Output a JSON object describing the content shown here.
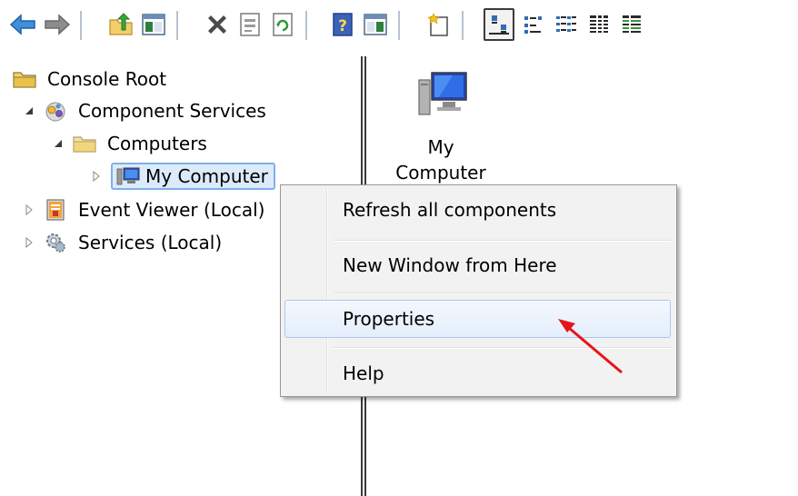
{
  "toolbar": {
    "buttons": [
      {
        "id": "back",
        "icon": "back-arrow-icon"
      },
      {
        "id": "forward",
        "icon": "forward-arrow-icon"
      },
      {
        "id": "up-one-level",
        "icon": "up-folder-icon"
      },
      {
        "id": "show-hide-console-tree",
        "icon": "console-tree-icon"
      },
      {
        "id": "delete",
        "icon": "delete-x-icon"
      },
      {
        "id": "properties",
        "icon": "properties-sheet-icon"
      },
      {
        "id": "refresh",
        "icon": "refresh-icon"
      },
      {
        "id": "help",
        "icon": "help-icon"
      },
      {
        "id": "show-hide-action-pane",
        "icon": "action-pane-icon"
      },
      {
        "id": "new-window",
        "icon": "new-window-icon"
      },
      {
        "id": "large-icons",
        "icon": "large-icons-view-icon"
      },
      {
        "id": "small-icons",
        "icon": "small-icons-view-icon"
      },
      {
        "id": "list",
        "icon": "list-view-icon"
      },
      {
        "id": "detail",
        "icon": "detail-view-icon"
      },
      {
        "id": "tree-detail",
        "icon": "tree-detail-icon"
      }
    ]
  },
  "tree": {
    "items": [
      {
        "label": "Console Root",
        "icon": "folder-icon"
      },
      {
        "label": "Component Services",
        "icon": "component-services-icon"
      },
      {
        "label": "Computers",
        "icon": "folder-icon"
      },
      {
        "label": "My Computer",
        "icon": "computer-icon"
      },
      {
        "label": "Event Viewer (Local)",
        "icon": "event-viewer-icon"
      },
      {
        "label": "Services (Local)",
        "icon": "services-gear-icon"
      }
    ]
  },
  "results": {
    "items": [
      {
        "label_line1": "My",
        "label_line2": "Computer",
        "icon": "computer-large-icon"
      }
    ]
  },
  "context_menu": {
    "items": [
      {
        "label": "Refresh all components"
      },
      {
        "label": "New Window from Here"
      },
      {
        "label": "Properties"
      },
      {
        "label": "Help"
      }
    ]
  },
  "colors": {
    "selection_border": "#7fb0e6",
    "selection_fill": "#dcebfc",
    "annotation_arrow": "#e8141a",
    "menu_background": "#f2f2f2"
  }
}
